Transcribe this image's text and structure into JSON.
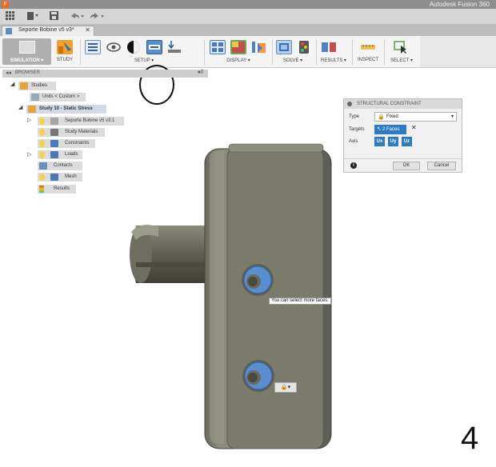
{
  "app": {
    "title": "Autodesk Fusion 360"
  },
  "document_tab": {
    "label": "Seporte Bobine v5 v3*",
    "close": "✕"
  },
  "workspace": {
    "label": "SIMULATION ▾"
  },
  "ribbon": {
    "study": "STUDY",
    "setup": "SETUP ▾",
    "display": "DISPLAY ▾",
    "solve": "SOLVE ▾",
    "results": "RESULTS ▾",
    "inspect": "INSPECT",
    "select": "SELECT ▾"
  },
  "browser": {
    "title": "BROWSER",
    "items": [
      {
        "label": "Studies"
      },
      {
        "label": "Units < Custom >"
      },
      {
        "label": "Study 10 - Static Stress"
      },
      {
        "label": "Seporte Bobine v5 v3:1"
      },
      {
        "label": "Study Materials"
      },
      {
        "label": "Constraints"
      },
      {
        "label": "Loads"
      },
      {
        "label": "Contacts"
      },
      {
        "label": "Mesh"
      },
      {
        "label": "Results"
      }
    ]
  },
  "dialog": {
    "title": "STRUCTURAL CONSTRAINT",
    "type_label": "Type",
    "type_value": "Fixed",
    "targets_label": "Targets",
    "targets_value": "2 Faces",
    "axis_label": "Axis",
    "axes": [
      "Ux",
      "Uy",
      "Uz"
    ],
    "ok": "OK",
    "cancel": "Cancel"
  },
  "tooltip": {
    "text": "You can select more faces."
  },
  "step_number": "4"
}
